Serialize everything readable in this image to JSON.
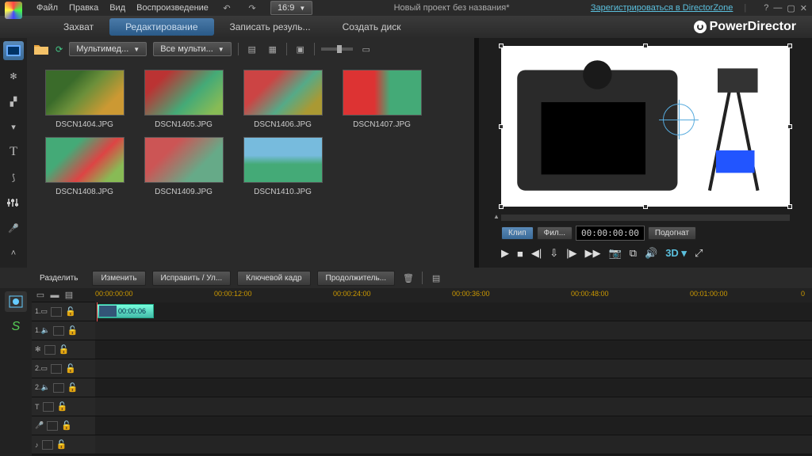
{
  "menu": {
    "file": "Файл",
    "edit": "Правка",
    "view": "Вид",
    "playback": "Воспроизведение"
  },
  "title": "Новый проект без названия*",
  "dz_link": "Зарегистрироваться в DirectorZone",
  "aspect": "16:9",
  "modes": {
    "capture": "Захват",
    "edit": "Редактирование",
    "produce": "Записать резуль...",
    "disc": "Создать диск"
  },
  "brand": "PowerDirector",
  "media_filter1": "Мультимед...",
  "media_filter2": "Все мульти...",
  "thumbs": [
    {
      "name": "DSCN1404.JPG"
    },
    {
      "name": "DSCN1405.JPG"
    },
    {
      "name": "DSCN1406.JPG"
    },
    {
      "name": "DSCN1407.JPG"
    },
    {
      "name": "DSCN1408.JPG"
    },
    {
      "name": "DSCN1409.JPG"
    },
    {
      "name": "DSCN1410.JPG"
    }
  ],
  "preview": {
    "tab_clip": "Клип",
    "tab_film": "Фил...",
    "timecode": "00:00:00:00",
    "fit": "Подогнат"
  },
  "tl_toolbar": {
    "split": "Разделить",
    "modify": "Изменить",
    "fix": "Исправить / Ул...",
    "keyframe": "Ключевой кадр",
    "duration": "Продолжитель..."
  },
  "ruler": [
    "00:00:00:00",
    "00:00:12:00",
    "00:00:24:00",
    "00:00:36:00",
    "00:00:48:00",
    "00:01:00:00"
  ],
  "clip_tc": "00:00:06",
  "tracks": [
    {
      "lbl": "1.",
      "icon": "video"
    },
    {
      "lbl": "1.",
      "icon": "audio"
    },
    {
      "lbl": "",
      "icon": "fx"
    },
    {
      "lbl": "2.",
      "icon": "video"
    },
    {
      "lbl": "2.",
      "icon": "audio"
    },
    {
      "lbl": "",
      "icon": "title"
    },
    {
      "lbl": "",
      "icon": "voice"
    },
    {
      "lbl": "",
      "icon": "music"
    }
  ]
}
